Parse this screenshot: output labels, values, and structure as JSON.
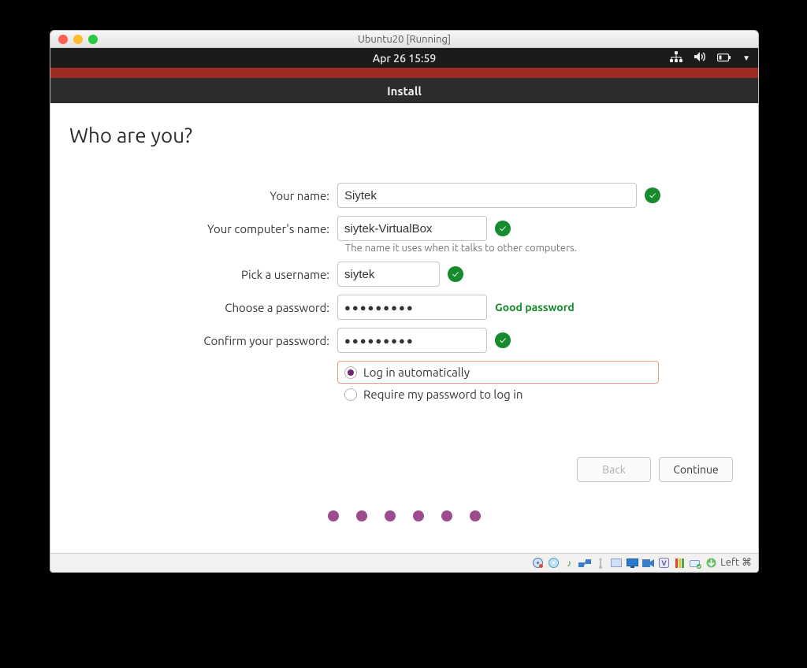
{
  "vbox": {
    "title": "Ubuntu20 [Running]",
    "status_right": "Left ⌘"
  },
  "topbar": {
    "time": "Apr 26  15:59"
  },
  "installer": {
    "window_title": "Install",
    "heading": "Who are you?",
    "labels": {
      "name": "Your name:",
      "computer": "Your computer's name:",
      "username": "Pick a username:",
      "password": "Choose a password:",
      "confirm": "Confirm your password:"
    },
    "values": {
      "name": "Siytek",
      "computer": "siytek-VirtualBox",
      "username": "siytek",
      "password": "●●●●●●●●●",
      "confirm": "●●●●●●●●●"
    },
    "computer_help": "The name it uses when it talks to other computers.",
    "password_strength": "Good password",
    "radio": {
      "auto": "Log in automatically",
      "require": "Require my password to log in"
    },
    "buttons": {
      "back": "Back",
      "continue": "Continue"
    }
  }
}
